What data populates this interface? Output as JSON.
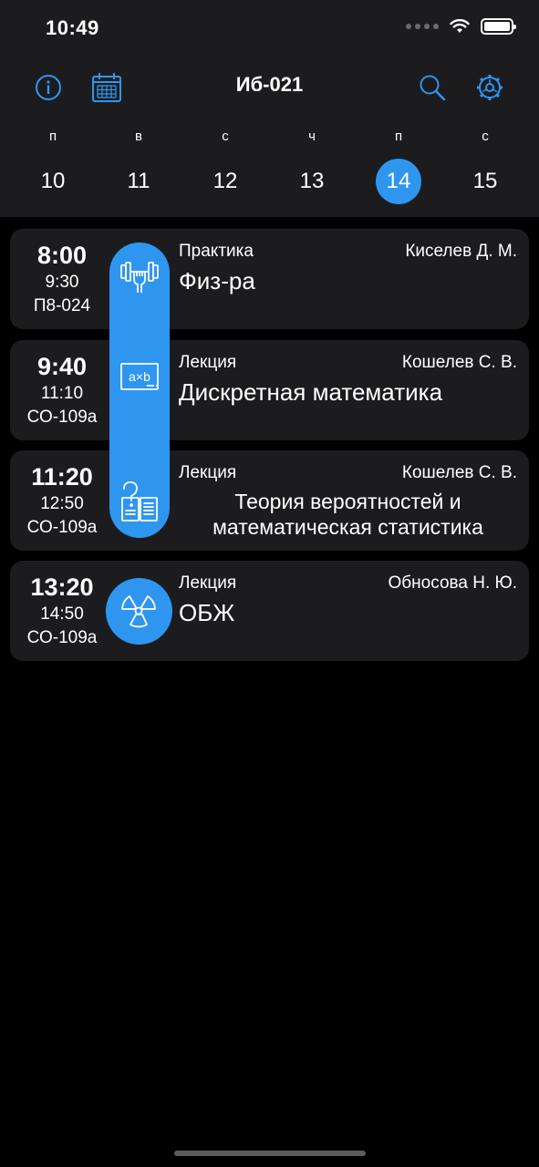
{
  "status_bar": {
    "time": "10:49"
  },
  "header": {
    "title": "Иб-021"
  },
  "week": [
    {
      "name": "п",
      "number": "10",
      "selected": false
    },
    {
      "name": "в",
      "number": "11",
      "selected": false
    },
    {
      "name": "с",
      "number": "12",
      "selected": false
    },
    {
      "name": "ч",
      "number": "13",
      "selected": false
    },
    {
      "name": "п",
      "number": "14",
      "selected": true
    },
    {
      "name": "с",
      "number": "15",
      "selected": false
    }
  ],
  "lessons": [
    {
      "start": "8:00",
      "end": "9:30",
      "room": "П8-024",
      "type": "Практика",
      "teacher": "Киселев Д. М.",
      "subject": "Физ-ра",
      "icon": "dumbbell-icon"
    },
    {
      "start": "9:40",
      "end": "11:10",
      "room": "СО-109а",
      "type": "Лекция",
      "teacher": "Кошелев С. В.",
      "subject": "Дискретная математика",
      "icon": "axb-board-icon"
    },
    {
      "start": "11:20",
      "end": "12:50",
      "room": "СО-109а",
      "type": "Лекция",
      "teacher": "Кошелев С. В.",
      "subject": "Теория вероятностей и математическая статистика",
      "icon": "question-book-icon"
    },
    {
      "start": "13:20",
      "end": "14:50",
      "room": "СО-109а",
      "type": "Лекция",
      "teacher": "Обносова Н. Ю.",
      "subject": "ОБЖ",
      "icon": "radiation-icon"
    }
  ],
  "colors": {
    "accent": "#2f96f0",
    "card": "#1c1c1e",
    "background": "#000000"
  }
}
